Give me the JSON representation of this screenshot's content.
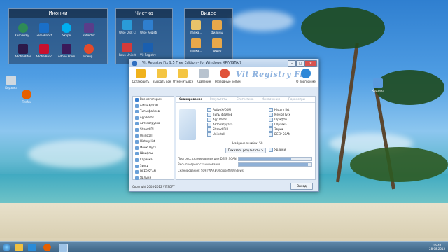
{
  "desktop": {
    "fences": [
      {
        "title": "Иконки",
        "icons": [
          "Kaspersky...",
          "GameBoost...",
          "Skype",
          "Reflector",
          "Adobe After Effects CS6",
          "Adobe Reader XI",
          "Adobe Premiere P...",
          "Tuneup..."
        ]
      },
      {
        "title": "Чистка",
        "icons": [
          "Wise Disk Cleaner",
          "Wise Registry Cleaner",
          "Revo Uninst...",
          "Vit Registry Fix 9.5"
        ]
      },
      {
        "title": "Видео",
        "icons": [
          "папка...",
          "фильмы",
          "папка...",
          "видео"
        ]
      }
    ],
    "left_icons": [
      "Корзина",
      "Firefox"
    ],
    "right_icons": [
      "Корзина"
    ]
  },
  "window": {
    "title": "Vit Registry Fix 9.5 Free Edition - for Windows XP/VISTA/7",
    "logo": "Vit Registry Fix",
    "toolbar": [
      "Остановить",
      "Выбрать все",
      "Отменить все",
      "Удаление",
      "Резервные копии",
      "О программе"
    ],
    "categories": [
      "Все категории",
      "ActiveX/COM",
      "Типы файлов",
      "App Paths",
      "Автозагрузка",
      "Shared DLL",
      "Uninstall",
      "History list",
      "Меню Пуск",
      "Шрифты",
      "Справка",
      "Звуки",
      "DEEP SCAN",
      "Ярлыки"
    ],
    "tabs": [
      "Сканирование",
      "Результаты",
      "Статистика",
      "Исключения",
      "Параметры"
    ],
    "checks_col1": [
      "ActiveX/COM",
      "Типы файлов",
      "App Paths",
      "Автозагрузка",
      "Shared DLL",
      "Uninstall"
    ],
    "checks_col2": [
      "History list",
      "Меню Пуск",
      "Шрифты",
      "Справка",
      "Звуки",
      "DEEP SCAN",
      "Ярлыки"
    ],
    "found_label": "Найдено ошибок:",
    "found_value": "50",
    "show_results": "Показать результаты >",
    "progress": [
      {
        "label": "Прогресс сканирования для DEEP SCAN",
        "fill": 0.72
      },
      {
        "label": "Весь прогресс сканирования",
        "fill": 0.95
      }
    ],
    "scan_path": "Сканирование: SOFTWARE\\Microsoft\\Windows",
    "copyright": "Copyright 2008-2012 VITSOFT",
    "exit": "Выход"
  },
  "taskbar": {
    "clock_time": "16:44",
    "clock_date": "28.08.2013"
  },
  "colors": {
    "accent": "#3c6384",
    "window_bg": "#dfe9f5"
  }
}
